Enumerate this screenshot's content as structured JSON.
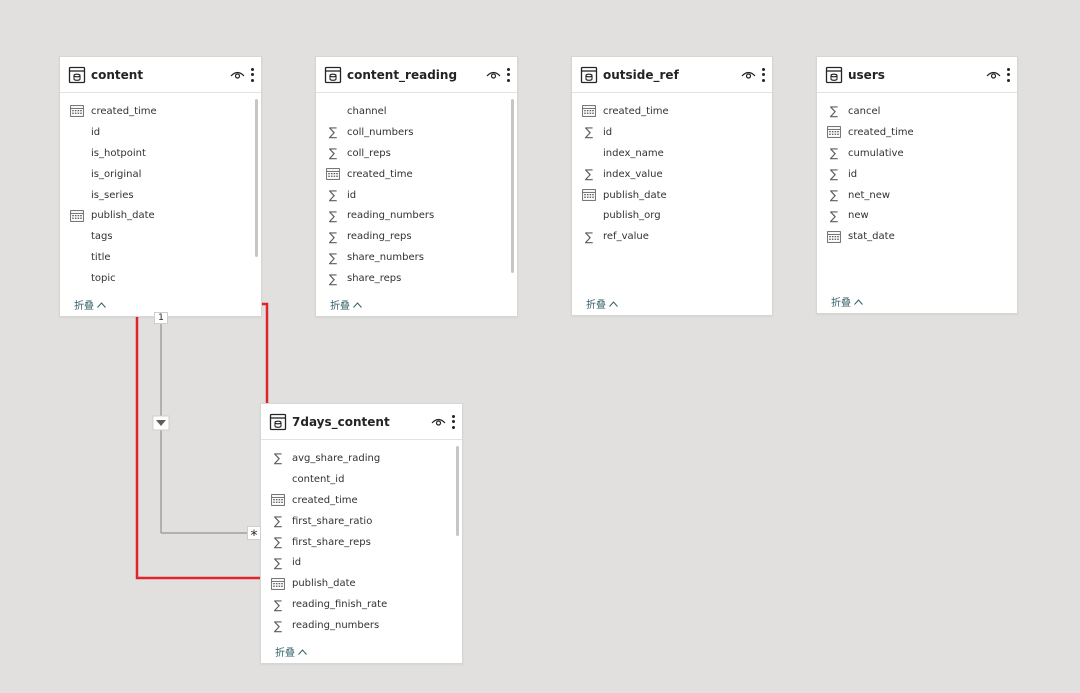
{
  "tables": {
    "content": {
      "title": "content",
      "collapse_label": "折叠",
      "fields": [
        {
          "name": "created_time",
          "icon": "calendar"
        },
        {
          "name": "id",
          "icon": "none"
        },
        {
          "name": "is_hotpoint",
          "icon": "none"
        },
        {
          "name": "is_original",
          "icon": "none"
        },
        {
          "name": "is_series",
          "icon": "none"
        },
        {
          "name": "publish_date",
          "icon": "calendar"
        },
        {
          "name": "tags",
          "icon": "none"
        },
        {
          "name": "title",
          "icon": "none"
        },
        {
          "name": "topic",
          "icon": "none"
        }
      ]
    },
    "content_reading": {
      "title": "content_reading",
      "collapse_label": "折叠",
      "fields": [
        {
          "name": "channel",
          "icon": "none"
        },
        {
          "name": "coll_numbers",
          "icon": "sigma"
        },
        {
          "name": "coll_reps",
          "icon": "sigma"
        },
        {
          "name": "created_time",
          "icon": "calendar"
        },
        {
          "name": "id",
          "icon": "sigma"
        },
        {
          "name": "reading_numbers",
          "icon": "sigma"
        },
        {
          "name": "reading_reps",
          "icon": "sigma"
        },
        {
          "name": "share_numbers",
          "icon": "sigma"
        },
        {
          "name": "share_reps",
          "icon": "sigma"
        }
      ]
    },
    "outside_ref": {
      "title": "outside_ref",
      "collapse_label": "折叠",
      "fields": [
        {
          "name": "created_time",
          "icon": "calendar"
        },
        {
          "name": "id",
          "icon": "sigma"
        },
        {
          "name": "index_name",
          "icon": "none"
        },
        {
          "name": "index_value",
          "icon": "sigma"
        },
        {
          "name": "publish_date",
          "icon": "calendar"
        },
        {
          "name": "publish_org",
          "icon": "none"
        },
        {
          "name": "ref_value",
          "icon": "sigma"
        }
      ]
    },
    "users": {
      "title": "users",
      "collapse_label": "折叠",
      "fields": [
        {
          "name": "cancel",
          "icon": "sigma"
        },
        {
          "name": "created_time",
          "icon": "calendar"
        },
        {
          "name": "cumulative",
          "icon": "sigma"
        },
        {
          "name": "id",
          "icon": "sigma"
        },
        {
          "name": "net_new",
          "icon": "sigma"
        },
        {
          "name": "new",
          "icon": "sigma"
        },
        {
          "name": "stat_date",
          "icon": "calendar"
        }
      ]
    },
    "days7_content": {
      "title": "7days_content",
      "collapse_label": "折叠",
      "fields": [
        {
          "name": "avg_share_rading",
          "icon": "sigma"
        },
        {
          "name": "content_id",
          "icon": "none"
        },
        {
          "name": "created_time",
          "icon": "calendar"
        },
        {
          "name": "first_share_ratio",
          "icon": "sigma"
        },
        {
          "name": "first_share_reps",
          "icon": "sigma"
        },
        {
          "name": "id",
          "icon": "sigma"
        },
        {
          "name": "publish_date",
          "icon": "calendar"
        },
        {
          "name": "reading_finish_rate",
          "icon": "sigma"
        },
        {
          "name": "reading_numbers",
          "icon": "sigma"
        }
      ]
    }
  },
  "relationship": {
    "one_side_label": "1",
    "many_side_label": "*",
    "highlight_color": "#e0242b",
    "line_color": "#a19f9d"
  },
  "icons": {
    "table": "table-icon",
    "view": "eye-icon",
    "more": "more-options-icon",
    "sigma": "sigma-icon",
    "calendar": "calendar-icon",
    "collapse": "chevron-up-icon",
    "filter_direction": "triangle-down-icon"
  }
}
